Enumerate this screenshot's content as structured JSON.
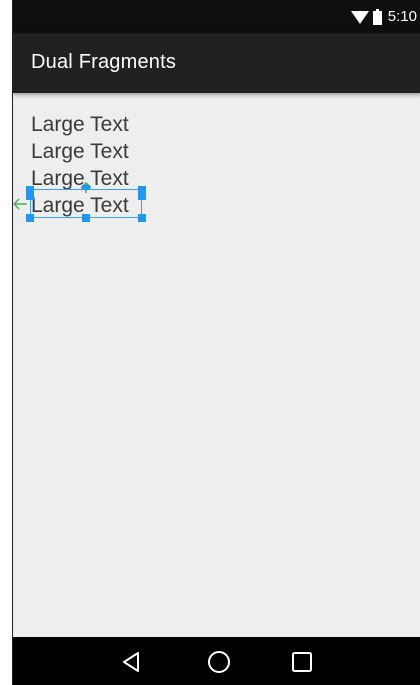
{
  "status_bar": {
    "time": "5:10",
    "icons": [
      "wifi-icon",
      "battery-icon"
    ]
  },
  "app_bar": {
    "title": "Dual Fragments"
  },
  "content": {
    "texts": [
      "Large Text",
      "Large Text",
      "Large Text",
      "Large Text"
    ]
  },
  "nav_bar": {
    "icons": [
      "back-icon",
      "home-icon",
      "recents-icon"
    ]
  },
  "colors": {
    "status_bar": "#0f0f0f",
    "app_bar": "#212121",
    "background": "#eeeeee",
    "selection": "#2196f3",
    "anchor": "#4caf50",
    "nav_bar": "#000000"
  }
}
